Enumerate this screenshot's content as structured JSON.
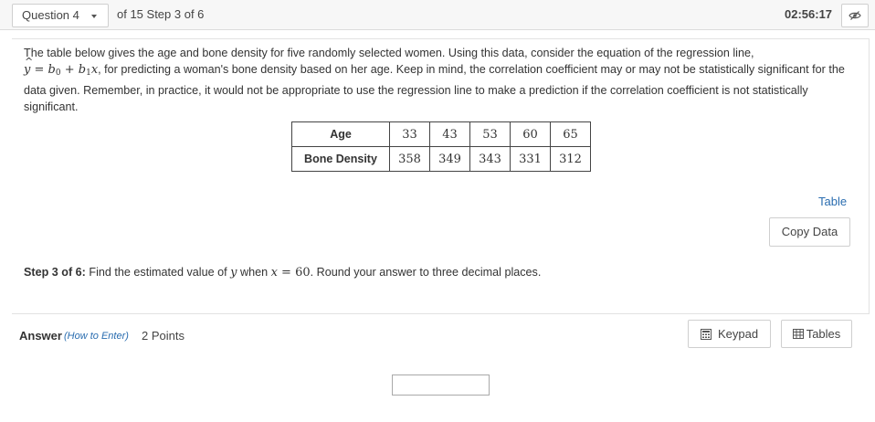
{
  "header": {
    "question_select": "Question 4",
    "of_step": "of 15 Step 3 of 6",
    "timer": "02:56:17"
  },
  "question": {
    "prompt_a": "The table below gives the age and bone density for five randomly selected women. Using this data, consider the equation of the regression line,",
    "equation": {
      "yhat": "y",
      "eq": " = ",
      "b": "b",
      "sub0": "0",
      "plus": " + ",
      "sub1": "1",
      "x": "x"
    },
    "prompt_b": ", for predicting a woman's bone density based on her age. Keep in mind, the correlation coefficient may or may not be statistically significant for the data given. Remember, in practice, it would not be appropriate to use the regression line to make a prediction if the correlation coefficient is not statistically significant.",
    "table": {
      "row1_label": "Age",
      "row1": [
        "33",
        "43",
        "53",
        "60",
        "65"
      ],
      "row2_label": "Bone Density",
      "row2": [
        "358",
        "349",
        "343",
        "331",
        "312"
      ]
    },
    "table_link": "Table",
    "copy_data": "Copy Data",
    "step_label": "Step 3 of 6:",
    "step_text_a": " Find the estimated value of ",
    "step_y": "y",
    "step_text_b": " when ",
    "step_x": "x",
    "step_eq": " = ",
    "step_val": "60",
    "step_text_c": ". Round your answer to three decimal places."
  },
  "answer": {
    "label": "Answer",
    "how_to": "(How to Enter)",
    "points": "2 Points",
    "keypad": "Keypad",
    "tables": "Tables",
    "value": ""
  },
  "icons": {
    "eye": "eye-slash-icon",
    "keypad": "calculator-icon",
    "tables": "table-grid-icon"
  }
}
